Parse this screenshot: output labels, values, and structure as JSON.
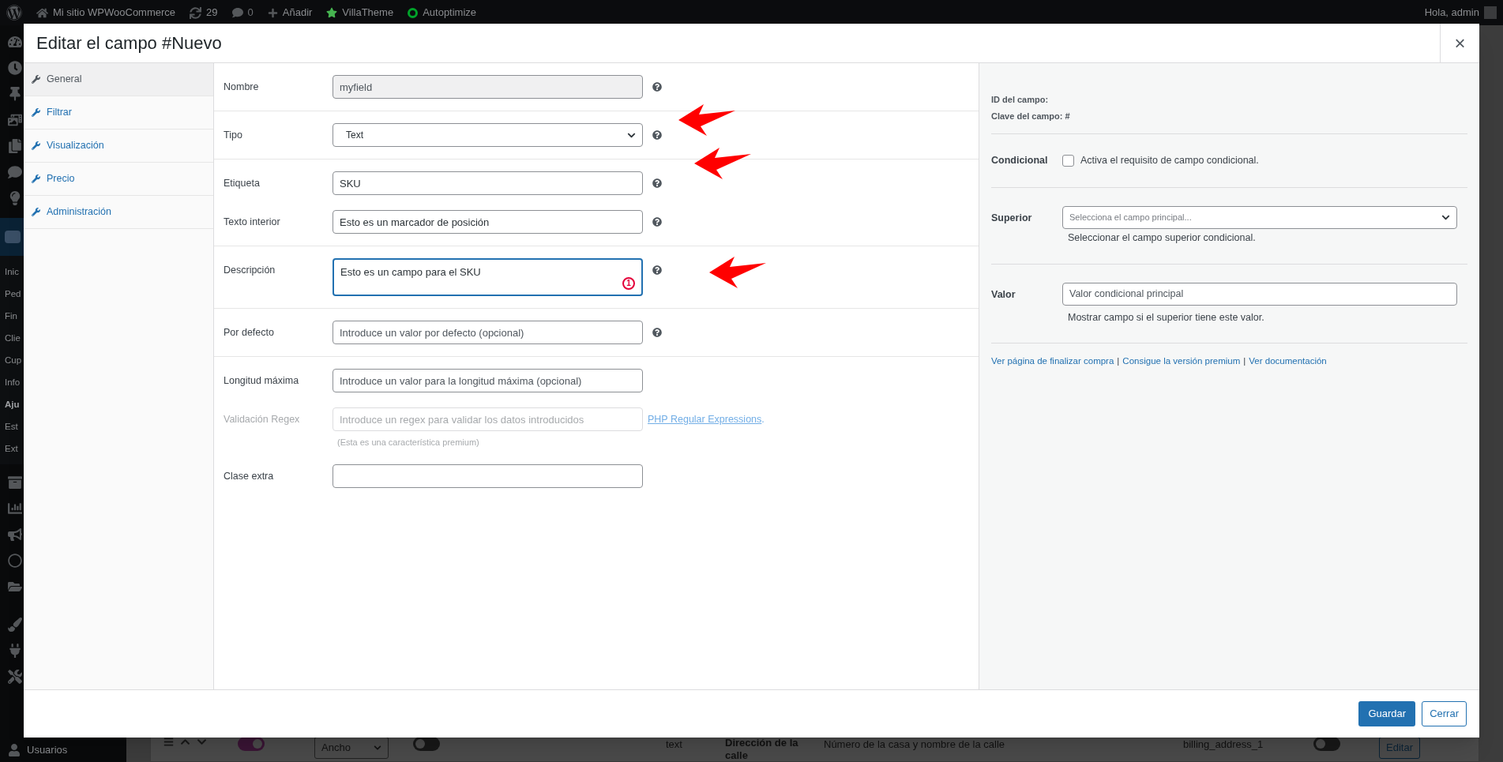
{
  "admin_bar": {
    "site": "Mi sitio WPWooCommerce",
    "updates": "29",
    "comments": "0",
    "new": "Añadir",
    "plugins": [
      {
        "label": "VillaTheme",
        "kind": "star"
      },
      {
        "label": "Autoptimize",
        "kind": "ring"
      }
    ],
    "greeting": "Hola, admin"
  },
  "admin_menu": {
    "submenu": [
      "Inic",
      "Ped",
      "Fin",
      "Clie",
      "Cup",
      "Info",
      "Aju",
      "Est",
      "Ext"
    ],
    "users": "Usuarios"
  },
  "background_row": [
    {
      "kind": "handle"
    },
    {
      "kind": "switch",
      "on": true
    },
    {
      "kind": "select",
      "text": "Ancho"
    },
    {
      "kind": "switch",
      "on": false
    },
    {
      "kind": "text",
      "text": "text"
    },
    {
      "kind": "strong",
      "text": "Dirección de la calle"
    },
    {
      "kind": "text",
      "text": "Número de la casa y nombre de la calle"
    },
    {
      "kind": "text",
      "text": "billing_address_1"
    },
    {
      "kind": "switch",
      "on": false
    },
    {
      "kind": "button",
      "text": "Editar"
    }
  ],
  "modal": {
    "title": "Editar el campo #Nuevo",
    "close": "×",
    "tabs": [
      {
        "label": "General",
        "selected": true
      },
      {
        "label": "Filtrar",
        "selected": false
      },
      {
        "label": "Visualización",
        "selected": false
      },
      {
        "label": "Precio",
        "selected": false
      },
      {
        "label": "Administración",
        "selected": false
      }
    ],
    "groups": [
      {
        "fields": [
          {
            "label": "Nombre",
            "kind": "text",
            "value": "myfield",
            "disabled": true,
            "help": true
          }
        ]
      },
      {
        "fields": [
          {
            "label": "Tipo",
            "kind": "select",
            "value": "Text",
            "disabled": false,
            "help": true
          }
        ]
      },
      {
        "fields": [
          {
            "label": "Etiqueta",
            "kind": "text",
            "value": "SKU",
            "disabled": false,
            "help": true
          },
          {
            "label": "Texto interior",
            "kind": "text",
            "value": "Esto es un marcador de posición",
            "disabled": false,
            "help": true
          }
        ]
      },
      {
        "fields": [
          {
            "label": "Descripción",
            "kind": "textarea",
            "value": "Esto es un campo para el SKU",
            "focused": true,
            "badge": "1",
            "help": true
          }
        ]
      },
      {
        "fields": [
          {
            "label": "Por defecto",
            "kind": "text",
            "placeholder": "Introduce un valor por defecto (opcional)",
            "disabled": false,
            "help": true
          }
        ]
      },
      {
        "fields": [
          {
            "label": "Longitud máxima",
            "kind": "text",
            "placeholder": "Introduce un valor para la longitud máxima (opcional)",
            "disabled": false,
            "help": false
          },
          {
            "label": "Validación Regex",
            "kind": "text",
            "placeholder": "Introduce un regex para validar los datos introducidos",
            "disabled": true,
            "help": false,
            "link": "PHP Regular Expressions",
            "link_suffix": ".",
            "note": "(Esta es una característica premium)"
          },
          {
            "label": "Clase extra",
            "kind": "text",
            "disabled": false,
            "help": false
          }
        ]
      }
    ],
    "side": {
      "meta": [
        "ID del campo:",
        "Clave del campo: #"
      ],
      "conditional": {
        "label": "Condicional",
        "checked": false,
        "text": "Activa el requisito de campo condicional."
      },
      "parent": {
        "label": "Superior",
        "placeholder": "Selecciona el campo principal...",
        "hint": "Seleccionar el campo superior condicional."
      },
      "value": {
        "label": "Valor",
        "placeholder": "Valor condicional principal",
        "hint": "Mostrar campo si el superior tiene este valor."
      },
      "links": [
        "Ver página de finalizar compra",
        "Consigue la versión premium",
        "Ver documentación"
      ],
      "separator": "|"
    },
    "buttons": [
      {
        "label": "Guardar",
        "kind": "primary"
      },
      {
        "label": "Cerrar",
        "kind": "secondary"
      }
    ]
  }
}
